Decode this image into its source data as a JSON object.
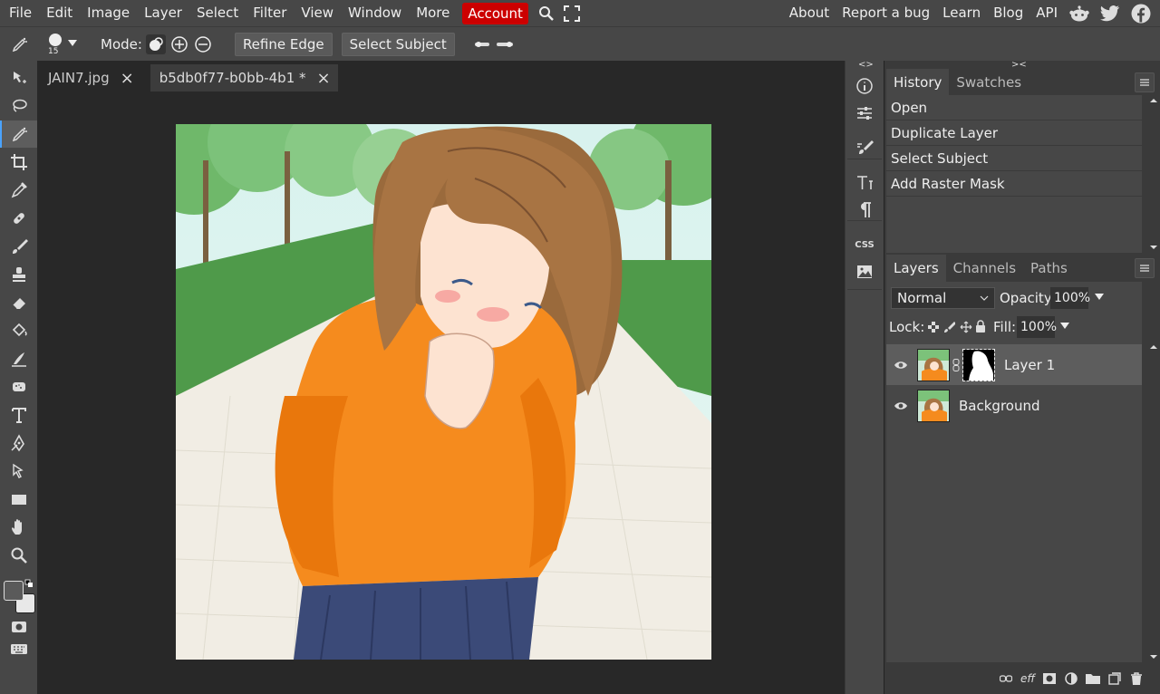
{
  "menu": {
    "items": [
      "File",
      "Edit",
      "Image",
      "Layer",
      "Select",
      "Filter",
      "View",
      "Window",
      "More"
    ],
    "account": "Account",
    "links": [
      "About",
      "Report a bug",
      "Learn",
      "Blog",
      "API"
    ]
  },
  "options": {
    "brush_size": "15",
    "mode_label": "Mode:",
    "refine_edge": "Refine Edge",
    "select_subject": "Select Subject"
  },
  "tabs": [
    {
      "label": "JAIN7.jpg",
      "close": "×"
    },
    {
      "label": "b5db0f77-b0bb-4b1 *",
      "close": "×"
    }
  ],
  "minipanel": {
    "collapse_left": "<>",
    "collapse_right": "><",
    "css_label": "CSS"
  },
  "history": {
    "tabs": [
      "History",
      "Swatches"
    ],
    "items": [
      "Open",
      "Duplicate Layer",
      "Select Subject",
      "Add Raster Mask"
    ]
  },
  "layers": {
    "tabs": [
      "Layers",
      "Channels",
      "Paths"
    ],
    "blend_mode": "Normal",
    "opacity_label": "Opacity:",
    "opacity_value": "100%",
    "lock_label": "Lock:",
    "fill_label": "Fill:",
    "fill_value": "100%",
    "list": [
      {
        "name": "Layer 1",
        "selected": true
      },
      {
        "name": "Background",
        "selected": false
      }
    ],
    "effects_label": "eff"
  },
  "colors": {
    "accent": "#4aa3ff",
    "account_bg": "#cc0000",
    "foreground": "#5a5a5a",
    "background": "#e8e8e8"
  }
}
